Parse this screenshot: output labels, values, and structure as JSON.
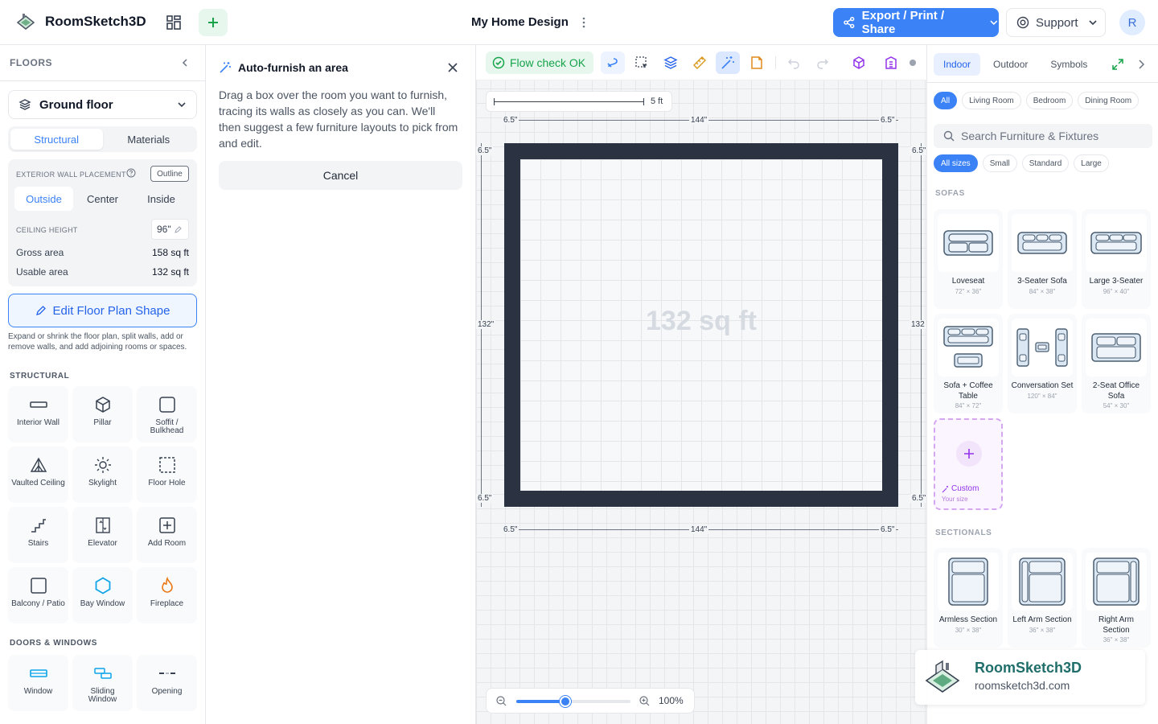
{
  "topbar": {
    "app_title": "RoomSketch3D",
    "doc_title": "My Home Design",
    "export_label": "Export / Print / Share",
    "support_label": "Support",
    "avatar_initial": "R"
  },
  "left": {
    "floors_heading": "FLOORS",
    "floor_selected": "Ground floor",
    "tabs": [
      "Structural",
      "Materials"
    ],
    "ewp_label": "EXTERIOR WALL PLACEMENT",
    "outline_badge": "Outline",
    "placement_options": [
      "Outside",
      "Center",
      "Inside"
    ],
    "ceiling_label": "CEILING HEIGHT",
    "ceiling_value": "96\"",
    "gross_label": "Gross area",
    "gross_value": "158 sq ft",
    "usable_label": "Usable area",
    "usable_value": "132 sq ft",
    "edit_shape_label": "Edit Floor Plan Shape",
    "edit_hint": "Expand or shrink the floor plan, split walls, add or remove walls, and add adjoining rooms or spaces.",
    "structural_heading": "STRUCTURAL",
    "structural_tools": [
      {
        "label": "Interior Wall",
        "icon": "wall-icon"
      },
      {
        "label": "Pillar",
        "icon": "pillar-icon"
      },
      {
        "label": "Soffit / Bulkhead",
        "icon": "soffit-icon"
      },
      {
        "label": "Vaulted Ceiling",
        "icon": "vaulted-ceiling-icon"
      },
      {
        "label": "Skylight",
        "icon": "skylight-icon"
      },
      {
        "label": "Floor Hole",
        "icon": "floor-hole-icon"
      },
      {
        "label": "Stairs",
        "icon": "stairs-icon"
      },
      {
        "label": "Elevator",
        "icon": "elevator-icon"
      },
      {
        "label": "Add Room",
        "icon": "add-room-icon"
      },
      {
        "label": "Balcony / Patio",
        "icon": "balcony-icon"
      },
      {
        "label": "Bay Window",
        "icon": "bay-window-icon"
      },
      {
        "label": "Fireplace",
        "icon": "fireplace-icon"
      }
    ],
    "doors_heading": "DOORS & WINDOWS",
    "door_tools": [
      {
        "label": "Window",
        "icon": "window-icon"
      },
      {
        "label": "Sliding Window",
        "icon": "sliding-window-icon"
      },
      {
        "label": "Opening",
        "icon": "opening-icon"
      }
    ]
  },
  "furnish": {
    "title": "Auto-furnish an area",
    "description": "Drag a box over the room you want to furnish, tracing its walls as closely as you can. We'll then suggest a few furniture layouts to pick from and edit.",
    "cancel_label": "Cancel"
  },
  "canvas": {
    "flow_check": "Flow check OK",
    "scale_label": "5 ft",
    "room_area": "132 sq ft",
    "dim_top": [
      "6.5\"",
      "144\"",
      "6.5\""
    ],
    "dim_bottom": [
      "6.5\"",
      "144\"",
      "6.5\""
    ],
    "dim_left": [
      "6.5\"",
      "132\"",
      "6.5\""
    ],
    "dim_right": [
      "6.5\"",
      "132",
      "6.5\""
    ],
    "zoom_percent": 100,
    "zoom_label": "100%",
    "accent_color": "#3b82f6",
    "wall_color": "#2b3342"
  },
  "right": {
    "tabs": [
      "Indoor",
      "Outdoor",
      "Symbols"
    ],
    "room_filters": [
      "All",
      "Living Room",
      "Bedroom",
      "Dining Room"
    ],
    "search_placeholder": "Search Furniture & Fixtures",
    "size_filters": [
      "All sizes",
      "Small",
      "Standard",
      "Large"
    ],
    "sofas_heading": "SOFAS",
    "sofas": [
      {
        "name": "Loveseat",
        "size": "72\" × 36\""
      },
      {
        "name": "3-Seater Sofa",
        "size": "84\" × 38\""
      },
      {
        "name": "Large 3-Seater",
        "size": "96\" × 40\""
      },
      {
        "name": "Sofa + Coffee Table",
        "size": "84\" × 72\""
      },
      {
        "name": "Conversation Set",
        "size": "120\" × 84\""
      },
      {
        "name": "2-Seat Office Sofa",
        "size": "54\" × 30\""
      }
    ],
    "custom_name": "Custom",
    "custom_size": "Your size",
    "sectionals_heading": "SECTIONALS",
    "sectionals": [
      {
        "name": "Armless Section",
        "size": "30\" × 38\""
      },
      {
        "name": "Left Arm Section",
        "size": "36\" × 38\""
      },
      {
        "name": "Right Arm Section",
        "size": "36\" × 38\""
      }
    ]
  },
  "watermark": {
    "title": "RoomSketch3D",
    "url": "roomsketch3d.com"
  }
}
